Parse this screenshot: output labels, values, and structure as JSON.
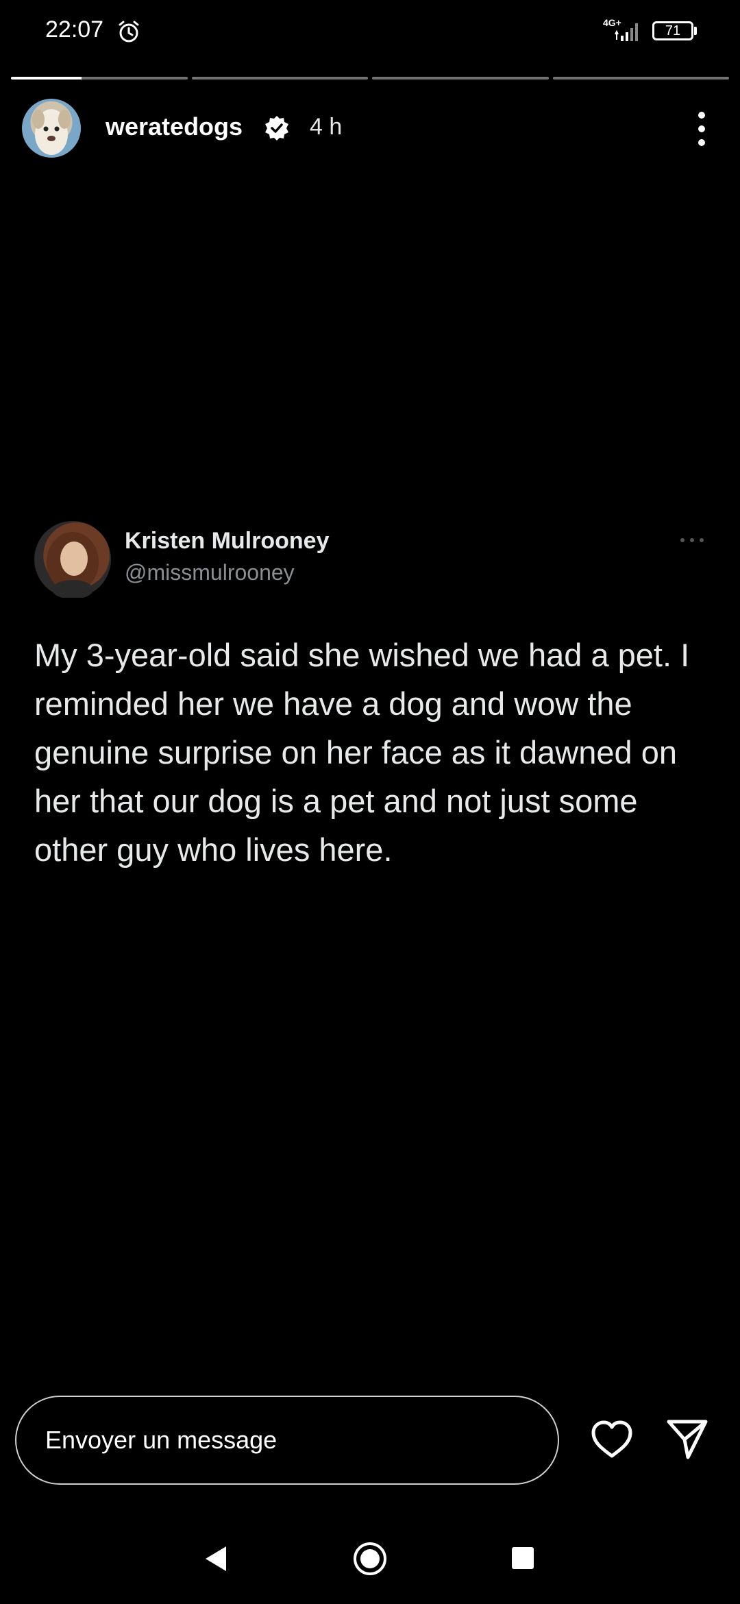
{
  "status_bar": {
    "time": "22:07",
    "network": "4G+",
    "battery": "71"
  },
  "story": {
    "progress": [
      0.4,
      0,
      0,
      0
    ],
    "username": "weratedogs",
    "time_ago": "4 h"
  },
  "tweet": {
    "name": "Kristen Mulrooney",
    "handle": "@missmulrooney",
    "text": "My 3-year-old said she wished we had a pet. I reminded her we have a dog and wow the genuine surprise on her face as it dawned on her that our dog is a pet and not just some other guy who lives here."
  },
  "reply": {
    "placeholder": "Envoyer un message"
  },
  "icons": {
    "alarm": "alarm-icon",
    "signal": "signal-icon",
    "verified": "verified-icon",
    "more": "more-vertical-icon",
    "heart": "heart-icon",
    "send": "send-icon"
  }
}
